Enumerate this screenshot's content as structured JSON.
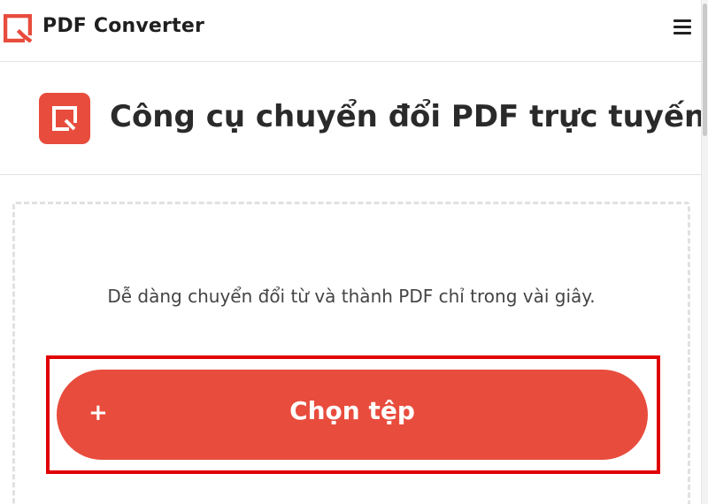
{
  "header": {
    "brand": "PDF Converter",
    "brand_color": "#e84c3d"
  },
  "hero": {
    "title": "Công cụ chuyển đổi PDF trực tuyến"
  },
  "dropzone": {
    "description": "Dễ dàng chuyển đổi từ và thành PDF chỉ trong vài giây.",
    "button_icon": "+",
    "button_label": "Chọn tệp",
    "button_color": "#e84c3d",
    "highlight_color": "#e00000"
  },
  "icons": [
    "logo-icon",
    "menu-icon",
    "pdf-converter-icon",
    "plus-icon"
  ]
}
